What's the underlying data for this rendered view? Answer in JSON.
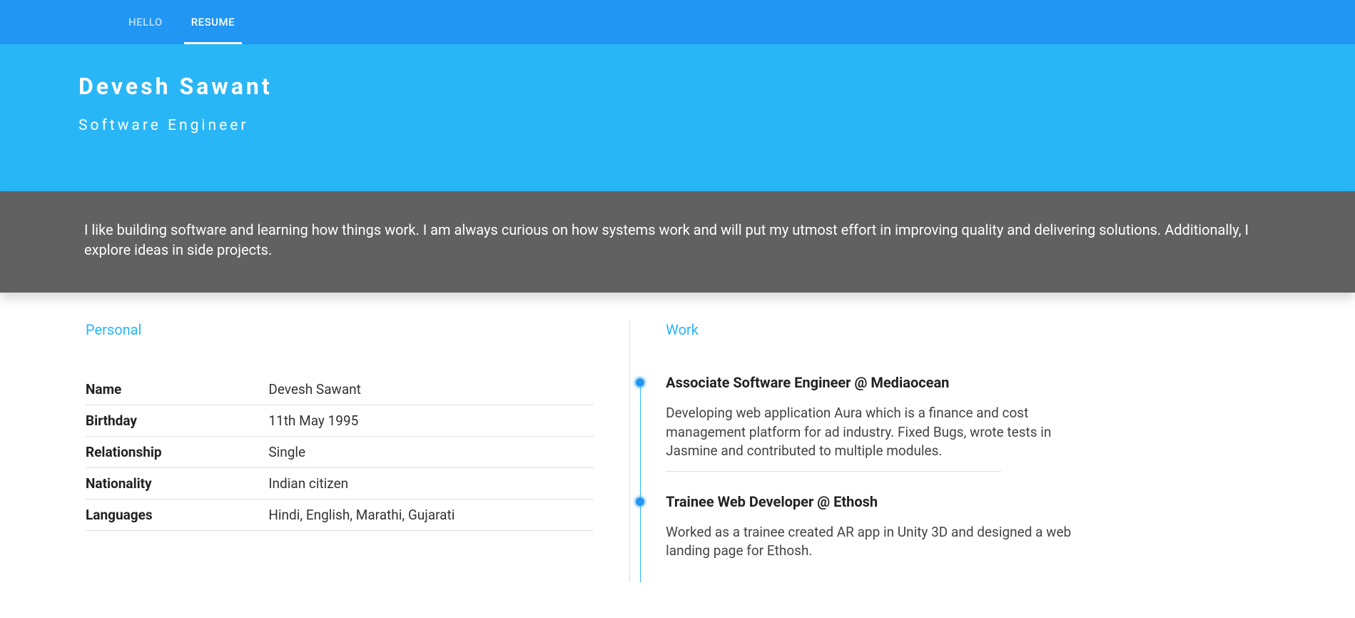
{
  "nav": {
    "items": [
      {
        "label": "HELLO",
        "active": false
      },
      {
        "label": "RESUME",
        "active": true
      }
    ]
  },
  "hero": {
    "name": "Devesh Sawant",
    "title": "Software Engineer"
  },
  "summary": {
    "text": "I like building software and learning how things work. I am always curious on how systems work and will put my utmost effort in improving quality and delivering solutions. Additionally, I explore ideas in side projects."
  },
  "sections": {
    "personal_title": "Personal",
    "work_title": "Work"
  },
  "personal": [
    {
      "label": "Name",
      "value": "Devesh Sawant"
    },
    {
      "label": "Birthday",
      "value": "11th May 1995"
    },
    {
      "label": "Relationship",
      "value": "Single"
    },
    {
      "label": "Nationality",
      "value": "Indian citizen"
    },
    {
      "label": "Languages",
      "value": "Hindi, English, Marathi, Gujarati"
    }
  ],
  "work": [
    {
      "title": "Associate Software Engineer @ Mediaocean",
      "desc": "Developing web application Aura which is a finance and cost management platform for ad industry. Fixed Bugs, wrote tests in Jasmine and contributed to multiple modules."
    },
    {
      "title": "Trainee Web Developer @ Ethosh",
      "desc": "Worked as a trainee created AR app in Unity 3D and designed a web landing page for Ethosh."
    }
  ]
}
